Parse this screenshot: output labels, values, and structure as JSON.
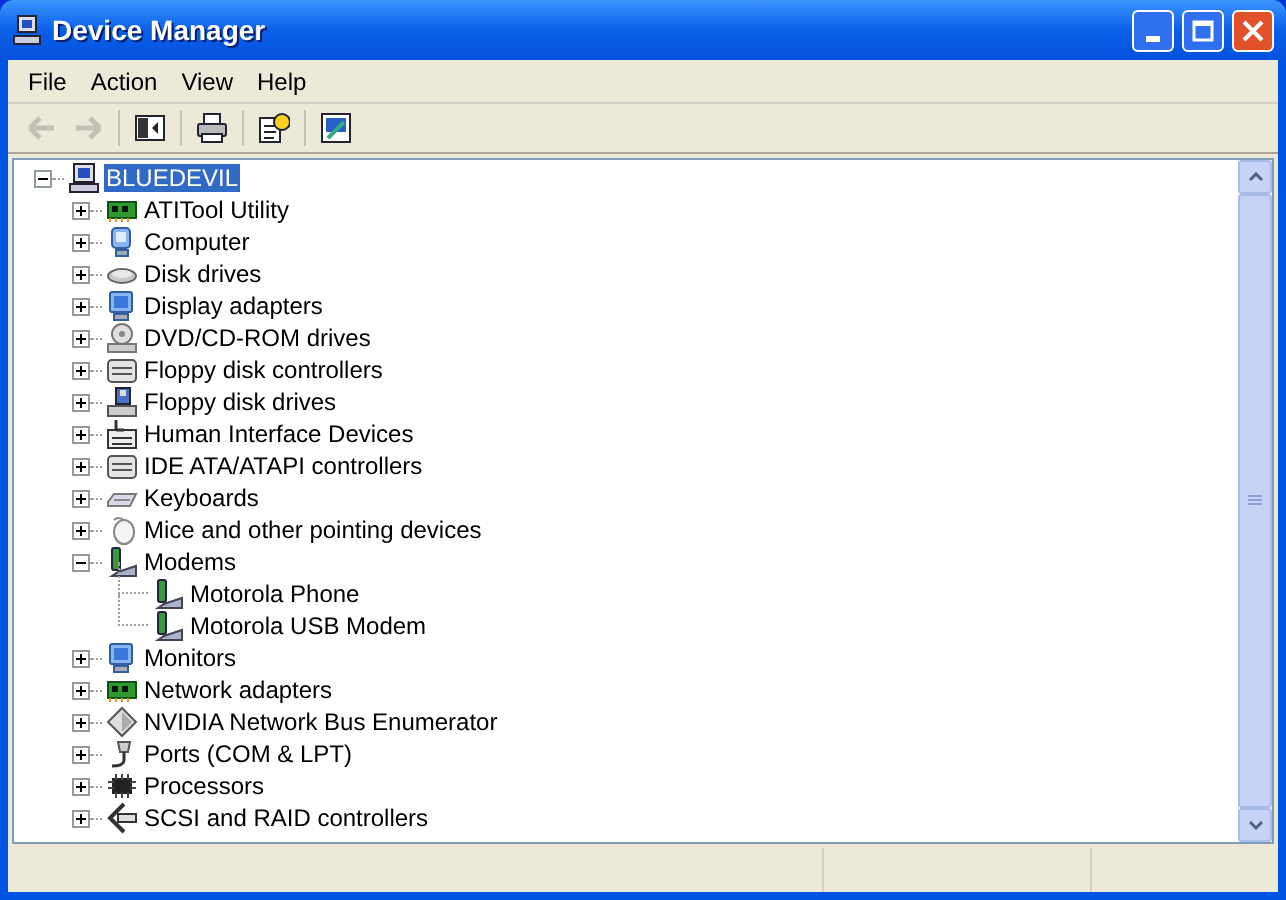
{
  "window": {
    "title": "Device Manager"
  },
  "menu": [
    {
      "label": "File"
    },
    {
      "label": "Action"
    },
    {
      "label": "View"
    },
    {
      "label": "Help"
    }
  ],
  "toolbar": [
    {
      "kind": "back",
      "disabled": true
    },
    {
      "kind": "forward",
      "disabled": true
    },
    {
      "kind": "tree",
      "disabled": false
    },
    {
      "kind": "print",
      "disabled": false
    },
    {
      "kind": "properties",
      "disabled": false
    },
    {
      "kind": "scan",
      "disabled": false
    }
  ],
  "tree": {
    "label": "BLUEDEVIL",
    "expanded": true,
    "selected": true,
    "children": [
      {
        "label": "ATITool Utility",
        "expanded": false,
        "selected": false
      },
      {
        "label": "Computer",
        "expanded": false,
        "selected": false
      },
      {
        "label": "Disk drives",
        "expanded": false,
        "selected": false
      },
      {
        "label": "Display adapters",
        "expanded": false,
        "selected": false
      },
      {
        "label": "DVD/CD-ROM drives",
        "expanded": false,
        "selected": false
      },
      {
        "label": "Floppy disk controllers",
        "expanded": false,
        "selected": false
      },
      {
        "label": "Floppy disk drives",
        "expanded": false,
        "selected": false
      },
      {
        "label": "Human Interface Devices",
        "expanded": false,
        "selected": false
      },
      {
        "label": "IDE ATA/ATAPI controllers",
        "expanded": false,
        "selected": false
      },
      {
        "label": "Keyboards",
        "expanded": false,
        "selected": false
      },
      {
        "label": "Mice and other pointing devices",
        "expanded": false,
        "selected": false
      },
      {
        "label": "Modems",
        "expanded": true,
        "selected": false,
        "children": [
          {
            "label": "Motorola Phone",
            "selected": false
          },
          {
            "label": "Motorola USB Modem",
            "selected": false
          }
        ]
      },
      {
        "label": "Monitors",
        "expanded": false,
        "selected": false
      },
      {
        "label": "Network adapters",
        "expanded": false,
        "selected": false
      },
      {
        "label": "NVIDIA Network Bus Enumerator",
        "expanded": false,
        "selected": false
      },
      {
        "label": "Ports (COM & LPT)",
        "expanded": false,
        "selected": false
      },
      {
        "label": "Processors",
        "expanded": false,
        "selected": false
      },
      {
        "label": "SCSI and RAID controllers",
        "expanded": false,
        "selected": false
      }
    ]
  }
}
